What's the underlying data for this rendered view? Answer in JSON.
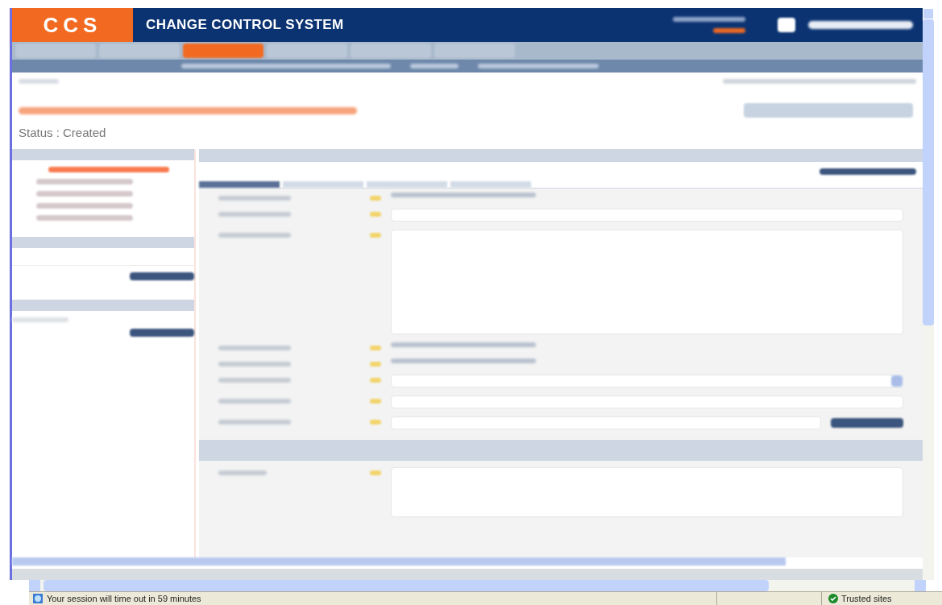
{
  "header": {
    "logo": "CCS",
    "title": "CHANGE CONTROL SYSTEM"
  },
  "nav_tabs": [
    {
      "selected": false
    },
    {
      "selected": false
    },
    {
      "selected": true
    },
    {
      "selected": false
    },
    {
      "selected": false
    },
    {
      "selected": false
    }
  ],
  "page": {
    "status": "Status : Created"
  },
  "sidebar": {
    "tree": [
      {
        "selected": true
      },
      {
        "selected": false
      },
      {
        "selected": false
      },
      {
        "selected": false
      },
      {
        "selected": false
      }
    ]
  },
  "form_tabs": [
    {
      "selected": true
    },
    {
      "selected": false
    },
    {
      "selected": false
    },
    {
      "selected": false
    }
  ],
  "form": {
    "rows": [
      {
        "kind": "plain"
      },
      {
        "kind": "text"
      },
      {
        "kind": "textarea"
      },
      {
        "kind": "plain"
      },
      {
        "kind": "plain"
      },
      {
        "kind": "select"
      },
      {
        "kind": "text"
      },
      {
        "kind": "lookup"
      }
    ]
  },
  "status_bar": {
    "message": "Your session will time out in 59 minutes",
    "zone": "Trusted sites"
  }
}
